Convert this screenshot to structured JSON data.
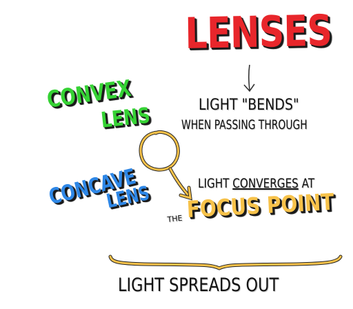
{
  "title": "Lenses",
  "convex": {
    "line1": "Convex",
    "line2": "Lens"
  },
  "concave": {
    "line1": "Concave",
    "line2": "Lens"
  },
  "bends": {
    "line1": "Light \"Bends\"",
    "line2": "When Passing Through"
  },
  "converges": {
    "prefix": "Light ",
    "word": "Converges",
    "suffix": " at"
  },
  "focus": {
    "the": "The",
    "label": "Focus Point"
  },
  "spreads": "Light Spreads Out",
  "colors": {
    "title": "#e8262b",
    "convex": "#35d234",
    "concave": "#2e87e6",
    "focus": "#f7c24a",
    "ink": "#111111"
  }
}
